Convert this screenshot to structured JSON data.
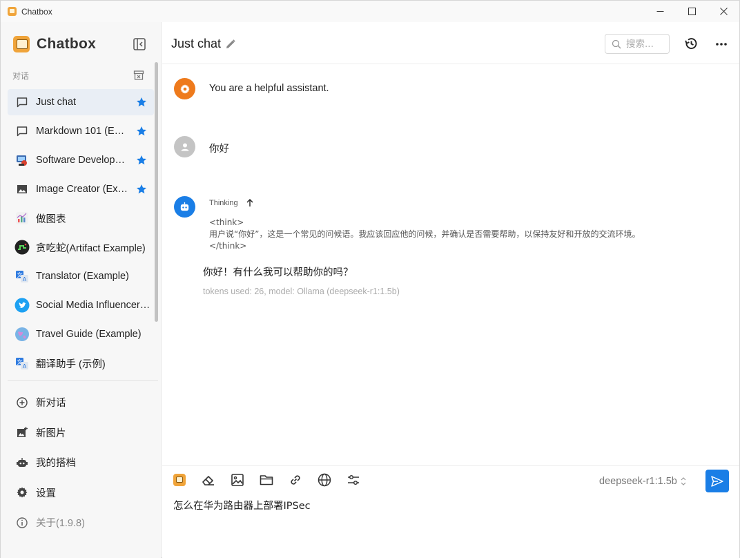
{
  "window": {
    "title": "Chatbox"
  },
  "sidebar": {
    "brand": "Chatbox",
    "section_label": "对话",
    "conversations": [
      {
        "label": "Just chat",
        "icon": "chat-bubble-icon",
        "starred": true,
        "active": true
      },
      {
        "label": "Markdown 101 (Example)",
        "icon": "chat-bubble-icon",
        "starred": true,
        "active": false
      },
      {
        "label": "Software Developer (Example)",
        "icon": "developer-avatar-icon",
        "starred": true,
        "active": false
      },
      {
        "label": "Image Creator (Example)",
        "icon": "image-icon",
        "starred": true,
        "active": false
      },
      {
        "label": "做图表",
        "icon": "chart-avatar-icon",
        "starred": false,
        "active": false
      },
      {
        "label": "贪吃蛇(Artifact Example)",
        "icon": "snake-avatar-icon",
        "starred": false,
        "active": false
      },
      {
        "label": "Translator (Example)",
        "icon": "translator-avatar-icon",
        "starred": false,
        "active": false
      },
      {
        "label": "Social Media Influencer (Example)",
        "icon": "twitter-avatar-icon",
        "starred": false,
        "active": false
      },
      {
        "label": "Travel Guide (Example)",
        "icon": "globe-avatar-icon",
        "starred": false,
        "active": false
      },
      {
        "label": "翻译助手 (示例)",
        "icon": "translator-avatar-icon",
        "starred": false,
        "active": false
      }
    ],
    "menu": [
      {
        "label": "新对话",
        "icon": "plus-circle-icon"
      },
      {
        "label": "新图片",
        "icon": "add-image-icon"
      },
      {
        "label": "我的搭档",
        "icon": "robot-icon"
      },
      {
        "label": "设置",
        "icon": "gear-icon"
      },
      {
        "label": "关于(1.9.8)",
        "icon": "info-icon"
      }
    ]
  },
  "header": {
    "title": "Just chat",
    "search_placeholder": "搜索..."
  },
  "messages": {
    "system": {
      "text": "You are a helpful assistant."
    },
    "user": {
      "text": "你好"
    },
    "assistant": {
      "thinking_label": "Thinking",
      "think_open": "<think>",
      "think_text": "用户说“你好”，这是一个常见的问候语。我应该回应他的问候，并确认是否需要帮助，以保持友好和开放的交流环境。",
      "think_close": "</think>",
      "answer": "你好！有什么我可以帮助你的吗？",
      "meta": "tokens used: 26, model: Ollama (deepseek-r1:1.5b)"
    }
  },
  "composer": {
    "model": "deepseek-r1:1.5b",
    "input_value": "怎么在华为路由器上部署IPSec"
  },
  "colors": {
    "accent": "#1a7ee6",
    "system_avatar": "#ee7a1c",
    "user_avatar": "#c4c4c4",
    "assistant_avatar": "#1a7ee6",
    "active_item": "#e9eef5"
  }
}
